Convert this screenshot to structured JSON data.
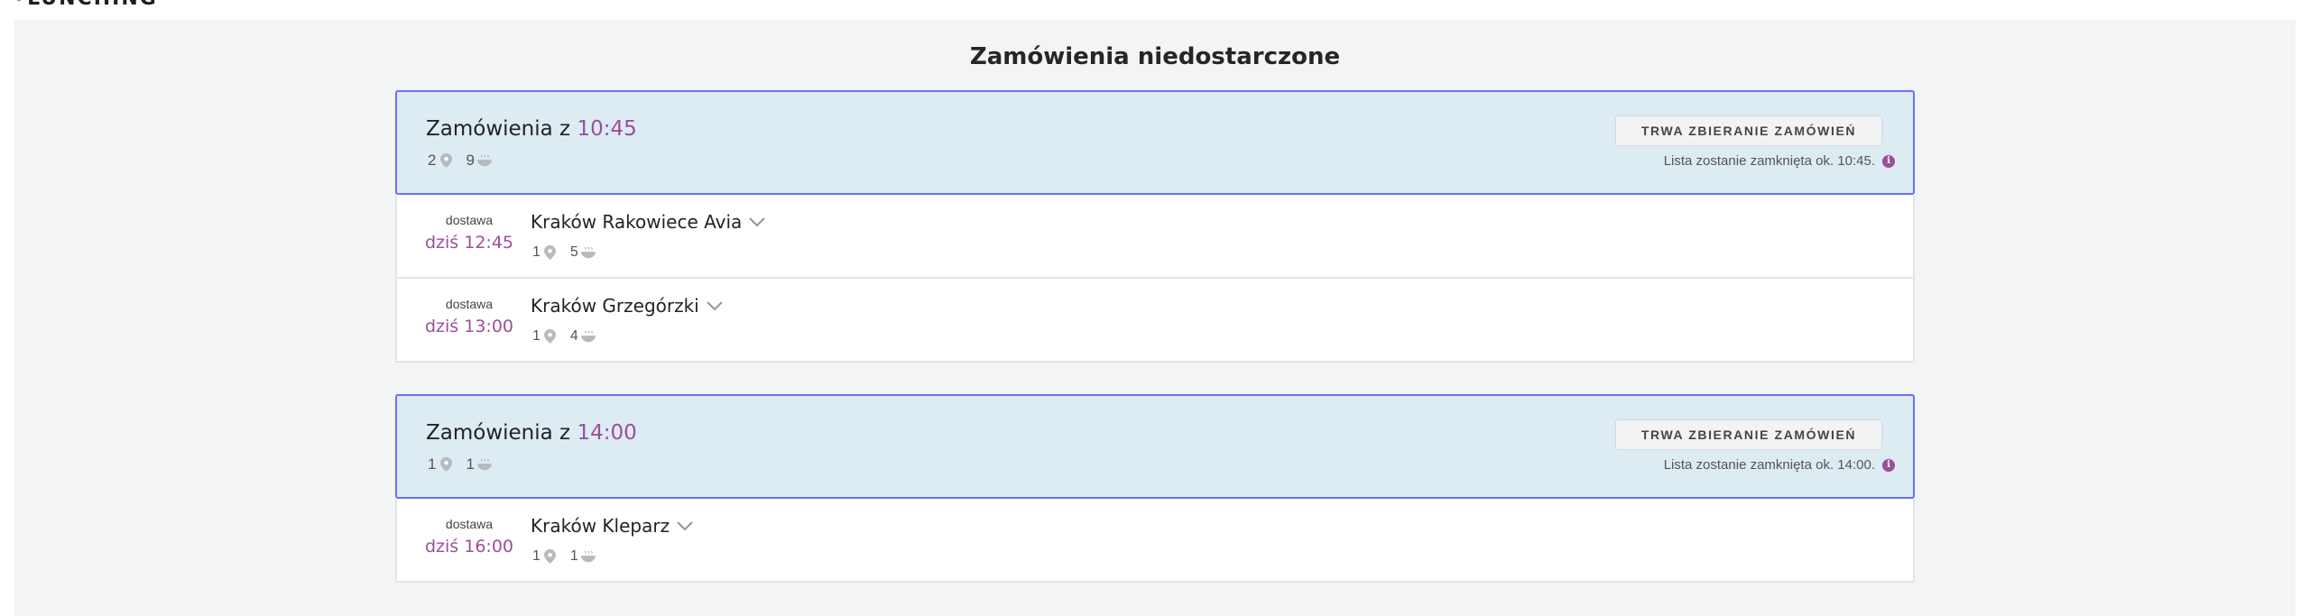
{
  "app": {
    "logo_text": "LUNCHING"
  },
  "page": {
    "title": "Zamówienia niedostarczone"
  },
  "groups": [
    {
      "title_prefix": "Zamówienia z",
      "time": "10:45",
      "locations_count": "2",
      "meals_count": "9",
      "status_button": "TRWA ZBIERANIE ZAMÓWIEŃ",
      "note": "Lista zostanie zamknięta ok. 10:45.",
      "rows": [
        {
          "type": "dostawa",
          "time": "dziś 12:45",
          "name": "Kraków Rakowiece Avia",
          "locations": "1",
          "meals": "5"
        },
        {
          "type": "dostawa",
          "time": "dziś 13:00",
          "name": "Kraków Grzegórzki",
          "locations": "1",
          "meals": "4"
        }
      ]
    },
    {
      "title_prefix": "Zamówienia z",
      "time": "14:00",
      "locations_count": "1",
      "meals_count": "1",
      "status_button": "TRWA ZBIERANIE ZAMÓWIEŃ",
      "note": "Lista zostanie zamknięta ok. 14:00.",
      "rows": [
        {
          "type": "dostawa",
          "time": "dziś 16:00",
          "name": "Kraków Kleparz",
          "locations": "1",
          "meals": "1"
        }
      ]
    }
  ],
  "icons": {
    "location": "map-pin-icon",
    "meal": "bowl-icon",
    "expand": "chevron-down-icon",
    "info": "info-icon"
  },
  "colors": {
    "accent": "#9b4f9a",
    "group_border": "#6d6ef0",
    "group_bg": "#ddebf2",
    "background": "#f3f4f6",
    "logo_dot": "#d62a3a"
  }
}
